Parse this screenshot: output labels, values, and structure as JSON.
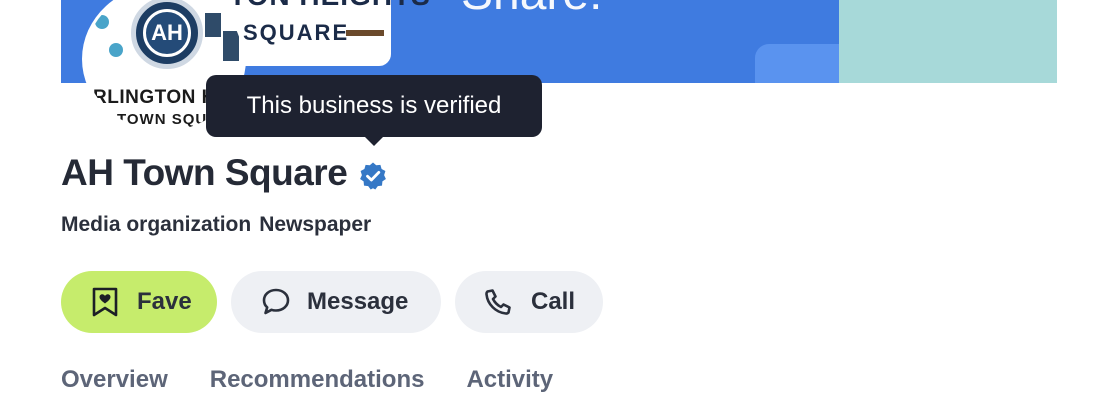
{
  "cover": {
    "logo_line1": "TON HEIGHTS",
    "logo_line2": "SQUARE",
    "headline": "Share!",
    "colors": {
      "blue": "#3f7be0",
      "teal": "#a7d9d9"
    }
  },
  "avatar": {
    "monogram": "AH",
    "line1": "RLINGTON HEI",
    "line2": "TOWN SQUAR"
  },
  "tooltip": {
    "text": "This business is verified"
  },
  "business": {
    "name": "AH Town Square",
    "verified_icon": "verified-badge-icon",
    "categories": [
      "Media organization",
      "Newspaper"
    ]
  },
  "actions": {
    "fave": {
      "label": "Fave",
      "icon": "bookmark-heart-icon",
      "color": "#c6ec6c"
    },
    "message": {
      "label": "Message",
      "icon": "chat-bubble-icon"
    },
    "call": {
      "label": "Call",
      "icon": "phone-icon"
    }
  },
  "tabs": [
    {
      "label": "Overview"
    },
    {
      "label": "Recommendations"
    },
    {
      "label": "Activity"
    }
  ]
}
